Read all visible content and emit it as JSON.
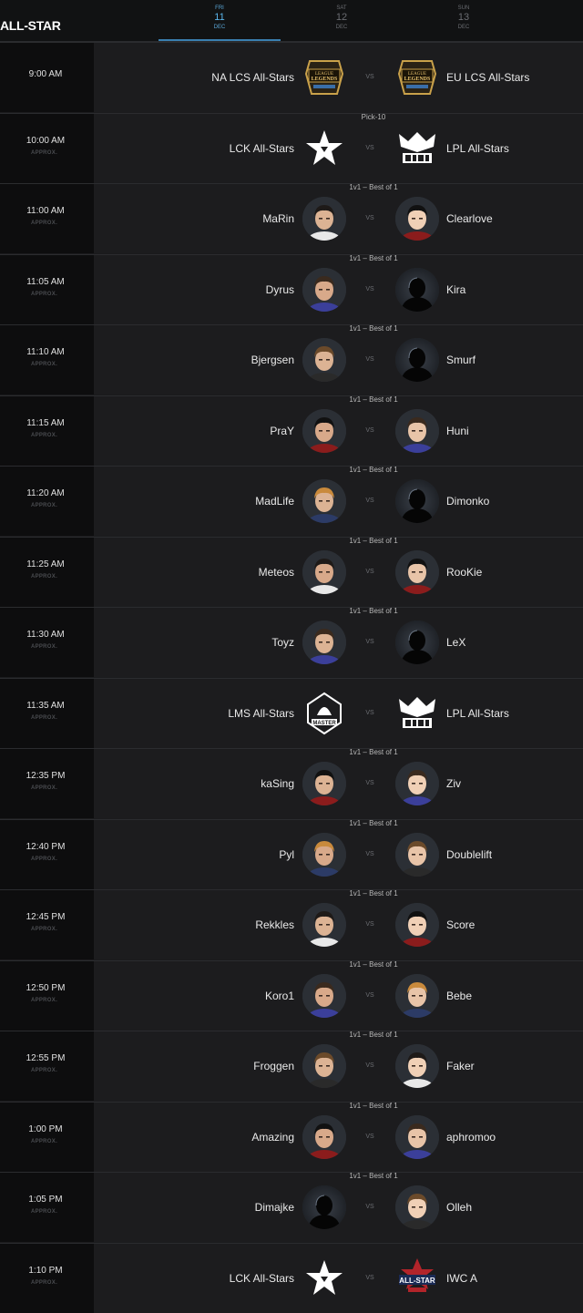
{
  "header": {
    "brand": "ALL-STAR",
    "days": [
      {
        "weekday": "FRI",
        "day": "11",
        "month": "DEC",
        "active": true
      },
      {
        "weekday": "SAT",
        "day": "12",
        "month": "DEC",
        "active": false
      },
      {
        "weekday": "SUN",
        "day": "13",
        "month": "DEC",
        "active": false
      }
    ]
  },
  "approx_label": "APPROX.",
  "vs_label": "VS",
  "matches": [
    {
      "time": "9:00 AM",
      "approx": false,
      "subtitle": "",
      "left": {
        "name": "NA LCS All-Stars",
        "kind": "lol-logo"
      },
      "right": {
        "name": "EU LCS All-Stars",
        "kind": "lol-logo"
      }
    },
    {
      "time": "10:00 AM",
      "approx": true,
      "subtitle": "Pick-10",
      "left": {
        "name": "LCK All-Stars",
        "kind": "star-logo"
      },
      "right": {
        "name": "LPL All-Stars",
        "kind": "lpl-logo"
      }
    },
    {
      "time": "11:00 AM",
      "approx": true,
      "subtitle": "1v1 – Best of 1",
      "left": {
        "name": "MaRin",
        "kind": "photo"
      },
      "right": {
        "name": "Clearlove",
        "kind": "photo"
      }
    },
    {
      "time": "11:05 AM",
      "approx": true,
      "subtitle": "1v1 – Best of 1",
      "left": {
        "name": "Dyrus",
        "kind": "photo"
      },
      "right": {
        "name": "Kira",
        "kind": "silhouette"
      }
    },
    {
      "time": "11:10 AM",
      "approx": true,
      "subtitle": "1v1 – Best of 1",
      "left": {
        "name": "Bjergsen",
        "kind": "photo"
      },
      "right": {
        "name": "Smurf",
        "kind": "silhouette"
      }
    },
    {
      "time": "11:15 AM",
      "approx": true,
      "subtitle": "1v1 – Best of 1",
      "left": {
        "name": "PraY",
        "kind": "photo"
      },
      "right": {
        "name": "Huni",
        "kind": "photo"
      }
    },
    {
      "time": "11:20 AM",
      "approx": true,
      "subtitle": "1v1 – Best of 1",
      "left": {
        "name": "MadLife",
        "kind": "photo"
      },
      "right": {
        "name": "Dimonko",
        "kind": "silhouette"
      }
    },
    {
      "time": "11:25 AM",
      "approx": true,
      "subtitle": "1v1 – Best of 1",
      "left": {
        "name": "Meteos",
        "kind": "photo"
      },
      "right": {
        "name": "RooKie",
        "kind": "photo"
      }
    },
    {
      "time": "11:30 AM",
      "approx": true,
      "subtitle": "1v1 – Best of 1",
      "left": {
        "name": "Toyz",
        "kind": "photo"
      },
      "right": {
        "name": "LeX",
        "kind": "silhouette"
      }
    },
    {
      "time": "11:35 AM",
      "approx": true,
      "subtitle": "",
      "left": {
        "name": "LMS All-Stars",
        "kind": "master-logo"
      },
      "right": {
        "name": "LPL All-Stars",
        "kind": "lpl-logo"
      }
    },
    {
      "time": "12:35 PM",
      "approx": true,
      "subtitle": "1v1 – Best of 1",
      "left": {
        "name": "kaSing",
        "kind": "photo"
      },
      "right": {
        "name": "Ziv",
        "kind": "photo"
      }
    },
    {
      "time": "12:40 PM",
      "approx": true,
      "subtitle": "1v1 – Best of 1",
      "left": {
        "name": "Pyl",
        "kind": "photo"
      },
      "right": {
        "name": "Doublelift",
        "kind": "photo"
      }
    },
    {
      "time": "12:45 PM",
      "approx": true,
      "subtitle": "1v1 – Best of 1",
      "left": {
        "name": "Rekkles",
        "kind": "photo"
      },
      "right": {
        "name": "Score",
        "kind": "photo"
      }
    },
    {
      "time": "12:50 PM",
      "approx": true,
      "subtitle": "1v1 – Best of 1",
      "left": {
        "name": "Koro1",
        "kind": "photo"
      },
      "right": {
        "name": "Bebe",
        "kind": "photo"
      }
    },
    {
      "time": "12:55 PM",
      "approx": true,
      "subtitle": "1v1 – Best of 1",
      "left": {
        "name": "Froggen",
        "kind": "photo"
      },
      "right": {
        "name": "Faker",
        "kind": "photo"
      }
    },
    {
      "time": "1:00 PM",
      "approx": true,
      "subtitle": "1v1 – Best of 1",
      "left": {
        "name": "Amazing",
        "kind": "photo"
      },
      "right": {
        "name": "aphromoo",
        "kind": "photo"
      }
    },
    {
      "time": "1:05 PM",
      "approx": true,
      "subtitle": "1v1 – Best of 1",
      "left": {
        "name": "Dimajke",
        "kind": "silhouette"
      },
      "right": {
        "name": "Olleh",
        "kind": "photo"
      }
    },
    {
      "time": "1:10 PM",
      "approx": true,
      "subtitle": "",
      "left": {
        "name": "LCK All-Stars",
        "kind": "star-logo"
      },
      "right": {
        "name": "IWC A",
        "kind": "allstar-logo"
      }
    }
  ]
}
